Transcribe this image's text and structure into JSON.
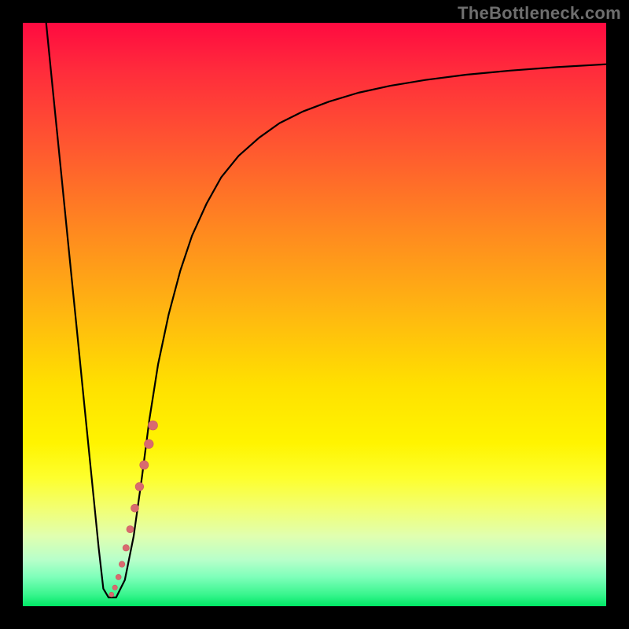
{
  "watermark": "TheBottleneck.com",
  "colors": {
    "frame": "#000000",
    "curve_stroke": "#000000",
    "marker_fill": "#d96a6f",
    "marker_stroke": "#c85a60"
  },
  "chart_data": {
    "type": "line",
    "title": "",
    "xlabel": "",
    "ylabel": "",
    "xlim": [
      0,
      100
    ],
    "ylim": [
      0,
      100
    ],
    "grid": false,
    "legend": false,
    "series": [
      {
        "name": "bottleneck-curve",
        "x_percent": [
          4.0,
          5.3,
          6.6,
          7.9,
          9.2,
          10.5,
          11.8,
          13.0,
          13.8,
          14.7,
          16.0,
          17.5,
          19.0,
          20.4,
          21.7,
          23.2,
          25.0,
          27.0,
          29.0,
          31.5,
          34.0,
          37.0,
          40.5,
          44.0,
          48.0,
          52.5,
          57.5,
          63.0,
          69.0,
          76.0,
          83.5,
          91.5,
          100.0
        ],
        "y_percent": [
          100.0,
          87.0,
          74.0,
          61.0,
          48.0,
          35.0,
          22.0,
          10.0,
          3.0,
          1.5,
          1.5,
          4.5,
          12.0,
          22.0,
          32.0,
          41.5,
          50.0,
          57.5,
          63.5,
          69.0,
          73.5,
          77.2,
          80.3,
          82.8,
          84.8,
          86.5,
          88.0,
          89.2,
          90.2,
          91.1,
          91.8,
          92.4,
          92.9
        ]
      }
    ],
    "markers": {
      "name": "highlighted-range",
      "style": "dotted-segment",
      "points": [
        {
          "x_percent": 15.2,
          "y_percent": 2.0,
          "r": 3.0
        },
        {
          "x_percent": 15.8,
          "y_percent": 3.2,
          "r": 3.2
        },
        {
          "x_percent": 16.4,
          "y_percent": 5.0,
          "r": 3.5
        },
        {
          "x_percent": 17.0,
          "y_percent": 7.2,
          "r": 3.8
        },
        {
          "x_percent": 17.7,
          "y_percent": 10.0,
          "r": 4.2
        },
        {
          "x_percent": 18.4,
          "y_percent": 13.2,
          "r": 4.6
        },
        {
          "x_percent": 19.2,
          "y_percent": 16.8,
          "r": 5.0
        },
        {
          "x_percent": 20.0,
          "y_percent": 20.5,
          "r": 5.3
        },
        {
          "x_percent": 20.8,
          "y_percent": 24.2,
          "r": 5.6
        },
        {
          "x_percent": 21.6,
          "y_percent": 27.8,
          "r": 5.8
        },
        {
          "x_percent": 22.3,
          "y_percent": 31.0,
          "r": 6.0
        }
      ]
    }
  }
}
